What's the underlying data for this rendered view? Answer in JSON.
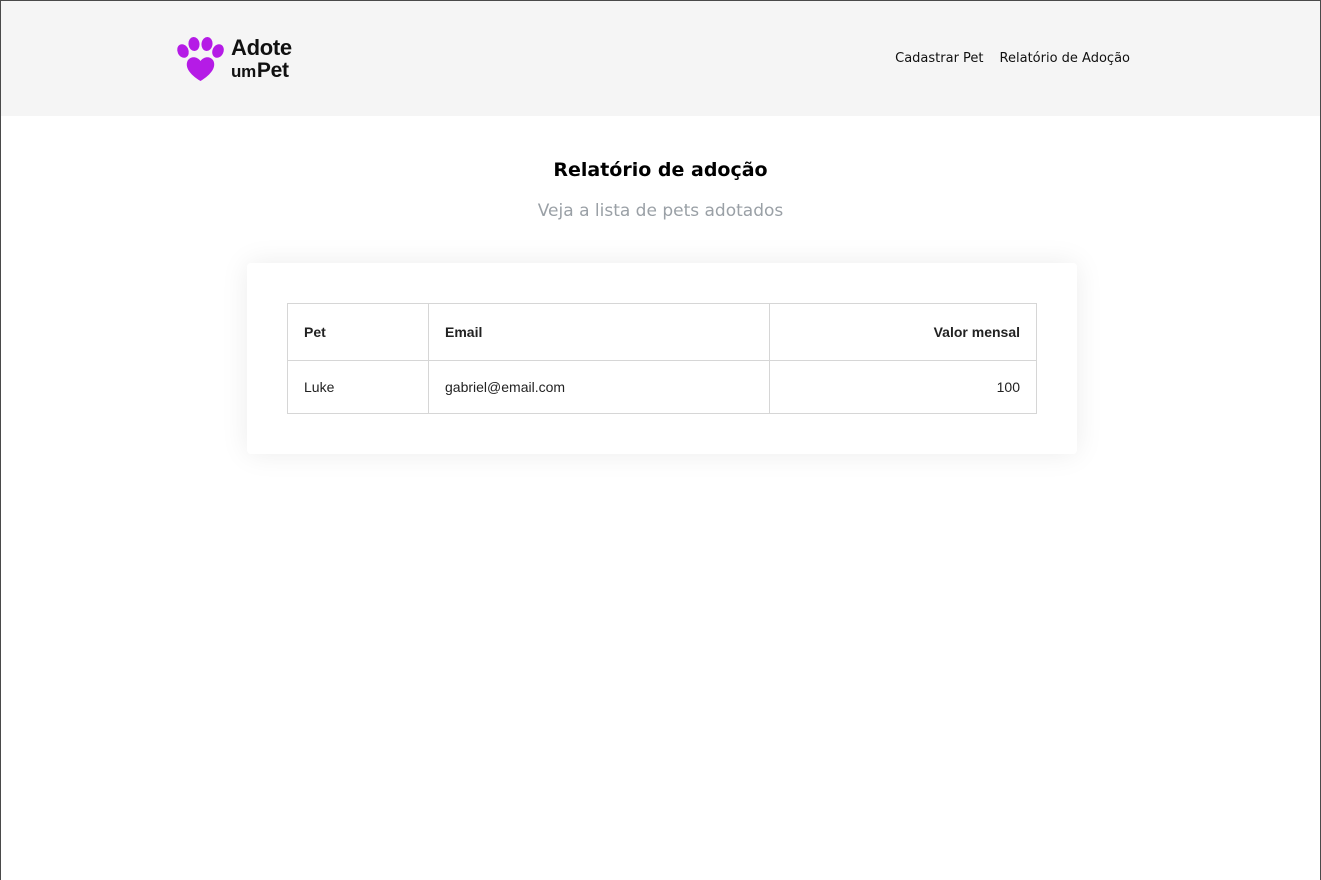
{
  "header": {
    "logo": {
      "line1": "Adote",
      "line2_a": "um",
      "line2_b": "Pet",
      "icon": "paw-heart-icon",
      "color": "#b51be6"
    },
    "nav": [
      {
        "label": "Cadastrar Pet"
      },
      {
        "label": "Relatório de Adoção"
      }
    ]
  },
  "main": {
    "title": "Relatório de adoção",
    "subtitle": "Veja a lista de pets adotados"
  },
  "table": {
    "headers": [
      "Pet",
      "Email",
      "Valor mensal"
    ],
    "rows": [
      [
        "Luke",
        "gabriel@email.com",
        "100"
      ]
    ]
  }
}
